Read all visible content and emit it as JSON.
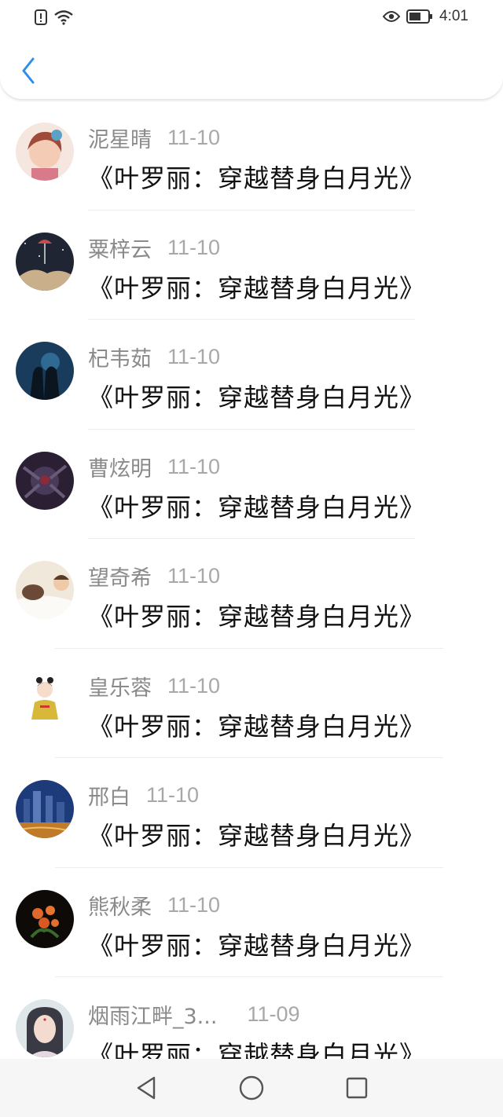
{
  "status_bar": {
    "time": "4:01",
    "icons": [
      "alert-icon",
      "wifi-icon",
      "eye-icon",
      "battery-icon"
    ]
  },
  "header": {
    "back_icon": "chevron-left-icon",
    "accent": "#2f8fe8"
  },
  "items": [
    {
      "name": "泥星晴",
      "date": "11-10",
      "message": "《叶罗丽：穿越替身白月光》"
    },
    {
      "name": "粟梓云",
      "date": "11-10",
      "message": "《叶罗丽：穿越替身白月光》"
    },
    {
      "name": "杞韦茹",
      "date": "11-10",
      "message": "《叶罗丽：穿越替身白月光》"
    },
    {
      "name": "曹炫明",
      "date": "11-10",
      "message": "《叶罗丽：穿越替身白月光》"
    },
    {
      "name": "望奇希",
      "date": "11-10",
      "message": "《叶罗丽：穿越替身白月光》"
    },
    {
      "name": "皇乐蓉",
      "date": "11-10",
      "message": "《叶罗丽：穿越替身白月光》"
    },
    {
      "name": "邢白",
      "date": "11-10",
      "message": "《叶罗丽：穿越替身白月光》"
    },
    {
      "name": "熊秋柔",
      "date": "11-10",
      "message": "《叶罗丽：穿越替身白月光》"
    },
    {
      "name": "烟雨江畔_3...",
      "date": "11-09",
      "message": "《叶罗丽：穿越替身白月光》"
    }
  ],
  "nav_bar": {
    "icons": [
      "back-triangle-icon",
      "home-circle-icon",
      "recent-square-icon"
    ]
  }
}
